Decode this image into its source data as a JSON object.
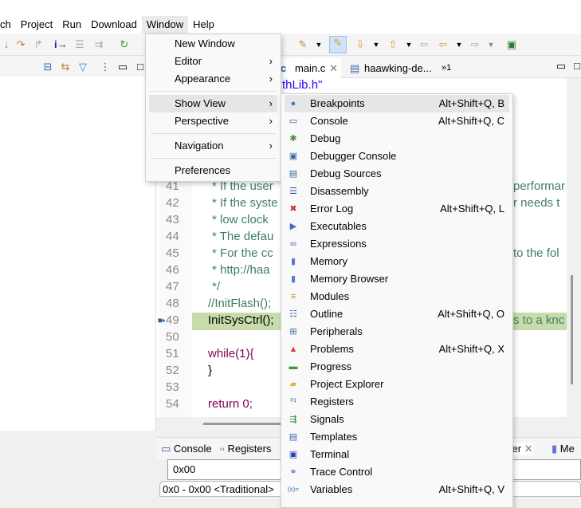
{
  "menubar": [
    "ch",
    "Project",
    "Run",
    "Download",
    "Window",
    "Help"
  ],
  "editor": {
    "tabs": [
      {
        "label": "main.c",
        "icon": "c-file-icon"
      },
      {
        "label": "haawking-de...",
        "icon": "document-icon"
      }
    ],
    "overflow": "»1",
    "include_fragment": "thLib.h\"",
    "lines": [
      {
        "n": "41",
        "left": "* If the user",
        "right": "performar",
        "type": "comment"
      },
      {
        "n": "42",
        "left": "* If the syste",
        "right": "r needs t",
        "type": "comment"
      },
      {
        "n": "43",
        "left": "* low clock",
        "right": "",
        "type": "comment"
      },
      {
        "n": "44",
        "left": "* The defau",
        "right": "",
        "type": "comment"
      },
      {
        "n": "45",
        "left": "* For the cc",
        "right": "to the fol",
        "type": "comment"
      },
      {
        "n": "46",
        "left": "* http://haa",
        "right": "",
        "type": "comment"
      },
      {
        "n": "47",
        "left": "*/",
        "right": "",
        "type": "comment"
      },
      {
        "n": "48",
        "left": "//InitFlash();",
        "right": "",
        "type": "comment"
      },
      {
        "n": "49",
        "left": "InitSysCtrl();",
        "right": "s to a knc",
        "type": "current"
      },
      {
        "n": "50",
        "left": "",
        "right": "",
        "type": "code"
      },
      {
        "n": "51",
        "left": "while(1){",
        "right": "",
        "type": "keyword"
      },
      {
        "n": "52",
        "left": "}",
        "right": "",
        "type": "code"
      },
      {
        "n": "53",
        "left": "",
        "right": "",
        "type": "code"
      },
      {
        "n": "54",
        "left": "return 0;",
        "right": "",
        "type": "keyword"
      }
    ]
  },
  "bottom": {
    "tabs": [
      "Console",
      "Registers",
      "ser",
      "Me"
    ],
    "address": "0x00",
    "rendering": "0x0 - 0x00 <Traditional>"
  },
  "window_menu": {
    "items": [
      {
        "label": "New Window"
      },
      {
        "label": "Editor",
        "submenu": true
      },
      {
        "label": "Appearance",
        "submenu": true
      },
      {
        "label": "Show View",
        "submenu": true,
        "selected": true
      },
      {
        "label": "Perspective",
        "submenu": true
      },
      {
        "label": "Navigation",
        "submenu": true
      },
      {
        "label": "Preferences"
      }
    ]
  },
  "show_view_menu": {
    "items": [
      {
        "label": "Breakpoints",
        "shortcut": "Alt+Shift+Q, B",
        "icon": "breakpoint-icon",
        "glyph": "●",
        "color": "#4a7ac0"
      },
      {
        "label": "Console",
        "shortcut": "Alt+Shift+Q, C",
        "icon": "console-icon",
        "glyph": "▭",
        "color": "#2a5a9a"
      },
      {
        "label": "Debug",
        "shortcut": "",
        "icon": "bug-icon",
        "glyph": "✱",
        "color": "#4a8a3a"
      },
      {
        "label": "Debugger Console",
        "shortcut": "",
        "icon": "debugger-console-icon",
        "glyph": "▣",
        "color": "#3a6a9a"
      },
      {
        "label": "Debug Sources",
        "shortcut": "",
        "icon": "debug-sources-icon",
        "glyph": "▤",
        "color": "#3a6a9a"
      },
      {
        "label": "Disassembly",
        "shortcut": "",
        "icon": "disassembly-icon",
        "glyph": "☰",
        "color": "#2a4ab0"
      },
      {
        "label": "Error Log",
        "shortcut": "Alt+Shift+Q, L",
        "icon": "error-log-icon",
        "glyph": "✖",
        "color": "#d03030"
      },
      {
        "label": "Executables",
        "shortcut": "",
        "icon": "executables-icon",
        "glyph": "▶",
        "color": "#4a6ac0"
      },
      {
        "label": "Expressions",
        "shortcut": "",
        "icon": "expressions-icon",
        "glyph": "∞",
        "color": "#3a6ab0"
      },
      {
        "label": "Memory",
        "shortcut": "",
        "icon": "memory-icon",
        "glyph": "▮",
        "color": "#5a7ad0"
      },
      {
        "label": "Memory Browser",
        "shortcut": "",
        "icon": "memory-browser-icon",
        "glyph": "▮",
        "color": "#5a7ad0"
      },
      {
        "label": "Modules",
        "shortcut": "",
        "icon": "modules-icon",
        "glyph": "≡",
        "color": "#c08020"
      },
      {
        "label": "Outline",
        "shortcut": "Alt+Shift+Q, O",
        "icon": "outline-icon",
        "glyph": "☷",
        "color": "#3a6ab0"
      },
      {
        "label": "Peripherals",
        "shortcut": "",
        "icon": "peripherals-icon",
        "glyph": "⊞",
        "color": "#3a6ab0"
      },
      {
        "label": "Problems",
        "shortcut": "Alt+Shift+Q, X",
        "icon": "problems-icon",
        "glyph": "▲",
        "color": "#d04040"
      },
      {
        "label": "Progress",
        "shortcut": "",
        "icon": "progress-icon",
        "glyph": "▬",
        "color": "#3a9a3a"
      },
      {
        "label": "Project Explorer",
        "shortcut": "",
        "icon": "folder-icon",
        "glyph": "▰",
        "color": "#e0b040"
      },
      {
        "label": "Registers",
        "shortcut": "",
        "icon": "registers-icon",
        "glyph": "⁰¹",
        "color": "#3a6ab0"
      },
      {
        "label": "Signals",
        "shortcut": "",
        "icon": "signals-icon",
        "glyph": "⇶",
        "color": "#3a8a3a"
      },
      {
        "label": "Templates",
        "shortcut": "",
        "icon": "templates-icon",
        "glyph": "▤",
        "color": "#3a6ab0"
      },
      {
        "label": "Terminal",
        "shortcut": "",
        "icon": "terminal-icon",
        "glyph": "▣",
        "color": "#2040c0"
      },
      {
        "label": "Trace Control",
        "shortcut": "",
        "icon": "trace-control-icon",
        "glyph": "⚭",
        "color": "#4a7ac0"
      },
      {
        "label": "Variables",
        "shortcut": "Alt+Shift+Q, V",
        "icon": "variables-icon",
        "glyph": "(x)=",
        "color": "#3a6ab0"
      }
    ]
  }
}
